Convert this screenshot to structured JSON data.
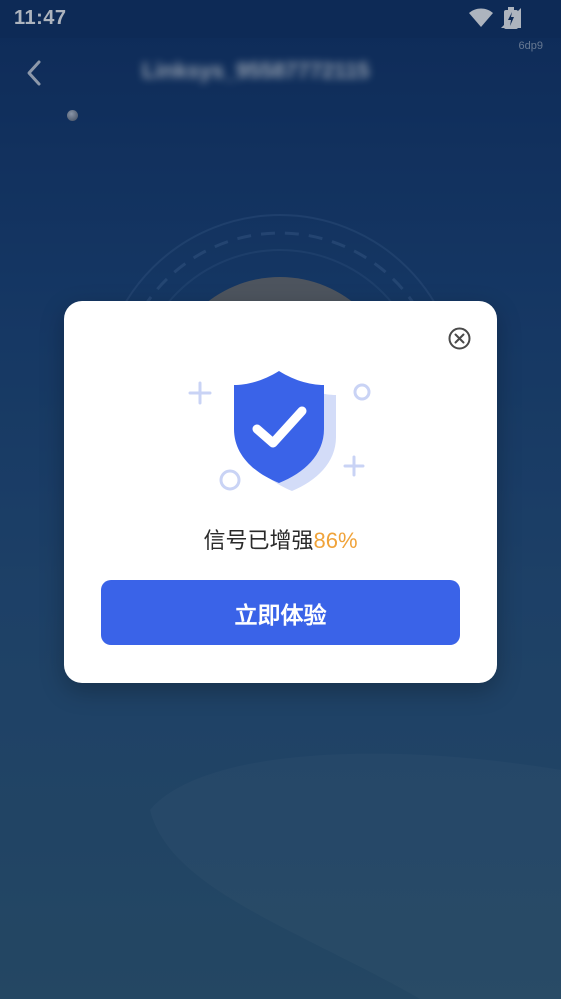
{
  "status_bar": {
    "time": "11:47",
    "icons": [
      "wifi-icon",
      "cellular-signal-icon",
      "battery-charging-icon"
    ]
  },
  "debug_tag": "6dp9",
  "nav": {
    "title": "Linksys_95587772115",
    "back_icon": "chevron-left-icon"
  },
  "dialog": {
    "close_icon": "close-circle-icon",
    "illustration_icon": "shield-check-icon",
    "message_prefix": "信号已增强",
    "message_value": "86%",
    "button_label": "立即体验"
  },
  "colors": {
    "primary_button": "#3a63e8",
    "highlight": "#f0a33a",
    "shield": "#3a63e8",
    "shield_shadow": "#c9d5f7",
    "background_top": "#0b2d63",
    "background_bottom": "#2d5873"
  }
}
